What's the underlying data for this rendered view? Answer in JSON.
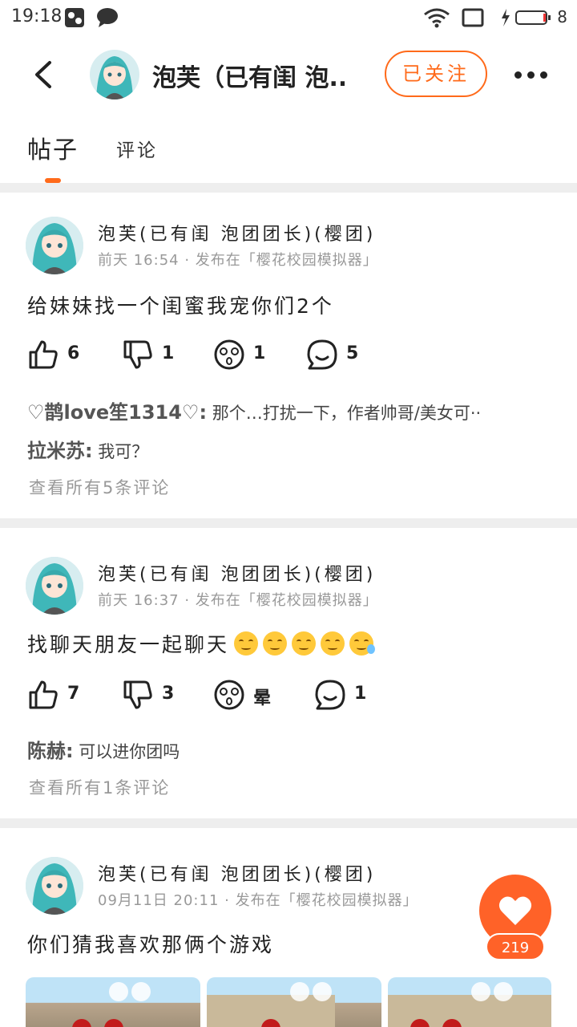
{
  "status_bar": {
    "time": "19:18",
    "battery_text": "8"
  },
  "header": {
    "title": "泡芙（已有闺 泡..",
    "follow_label": "已关注"
  },
  "tabs": [
    {
      "label": "帖子",
      "active": true
    },
    {
      "label": "评论",
      "active": false
    }
  ],
  "colors": {
    "accent": "#ff6a1a",
    "divider": "#eeeeee",
    "meta": "#999999"
  },
  "posts": [
    {
      "author": "泡芙(已有闺 泡团团长)(樱团)",
      "meta": "前天 16:54 · 发布在「樱花校园模拟器」",
      "text": "给妹妹找一个闺蜜我宠你们2个",
      "likes": "6",
      "dislikes": "1",
      "dizzy": "1",
      "comments": "5",
      "comment_lines": [
        {
          "user": "♡鹊love笙1314♡:",
          "text": "那个…打扰一下，作者帅哥/美女可··"
        },
        {
          "user": "拉米苏:",
          "text": "我可？"
        }
      ],
      "view_all": "查看所有5条评论"
    },
    {
      "author": "泡芙(已有闺 泡团团长)(樱团)",
      "meta": "前天 16:37 · 发布在「樱花校园模拟器」",
      "text": "找聊天朋友一起聊天",
      "likes": "7",
      "dislikes": "3",
      "dizzy": "晕",
      "comments": "1",
      "comment_lines": [
        {
          "user": "陈赫:",
          "text": "可以进你团吗"
        }
      ],
      "view_all": "查看所有1条评论"
    },
    {
      "author": "泡芙(已有闺 泡团团长)(樱团)",
      "meta": "09月11日 20:11 · 发布在「樱花校园模拟器」",
      "text": "你们猜我喜欢那俩个游戏"
    }
  ],
  "fab": {
    "count": "219"
  }
}
